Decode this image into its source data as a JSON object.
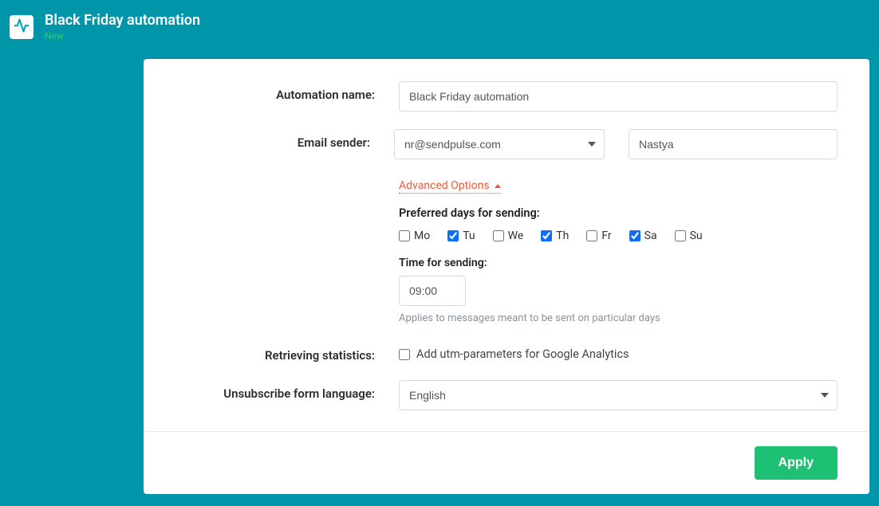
{
  "header": {
    "title": "Black Friday automation",
    "status": "New",
    "icon": "activity-icon"
  },
  "form": {
    "automation_name": {
      "label": "Automation name:",
      "value": "Black Friday automation"
    },
    "email_sender": {
      "label": "Email sender:",
      "selected": "nr@sendpulse.com",
      "name_value": "Nastya"
    },
    "advanced": {
      "link_label": "Advanced Options",
      "preferred_days_label": "Preferred days for sending:",
      "days": [
        {
          "code": "Mo",
          "checked": false
        },
        {
          "code": "Tu",
          "checked": true
        },
        {
          "code": "We",
          "checked": false
        },
        {
          "code": "Th",
          "checked": true
        },
        {
          "code": "Fr",
          "checked": false
        },
        {
          "code": "Sa",
          "checked": true
        },
        {
          "code": "Su",
          "checked": false
        }
      ],
      "time_label": "Time for sending:",
      "time_value": "09:00",
      "time_hint": "Applies to messages meant to be sent on particular days"
    },
    "stats": {
      "label": "Retrieving statistics:",
      "checkbox_label": "Add utm-parameters for Google Analytics",
      "checked": false
    },
    "unsubscribe": {
      "label": "Unsubscribe form language:",
      "selected": "English"
    }
  },
  "footer": {
    "apply_label": "Apply"
  }
}
